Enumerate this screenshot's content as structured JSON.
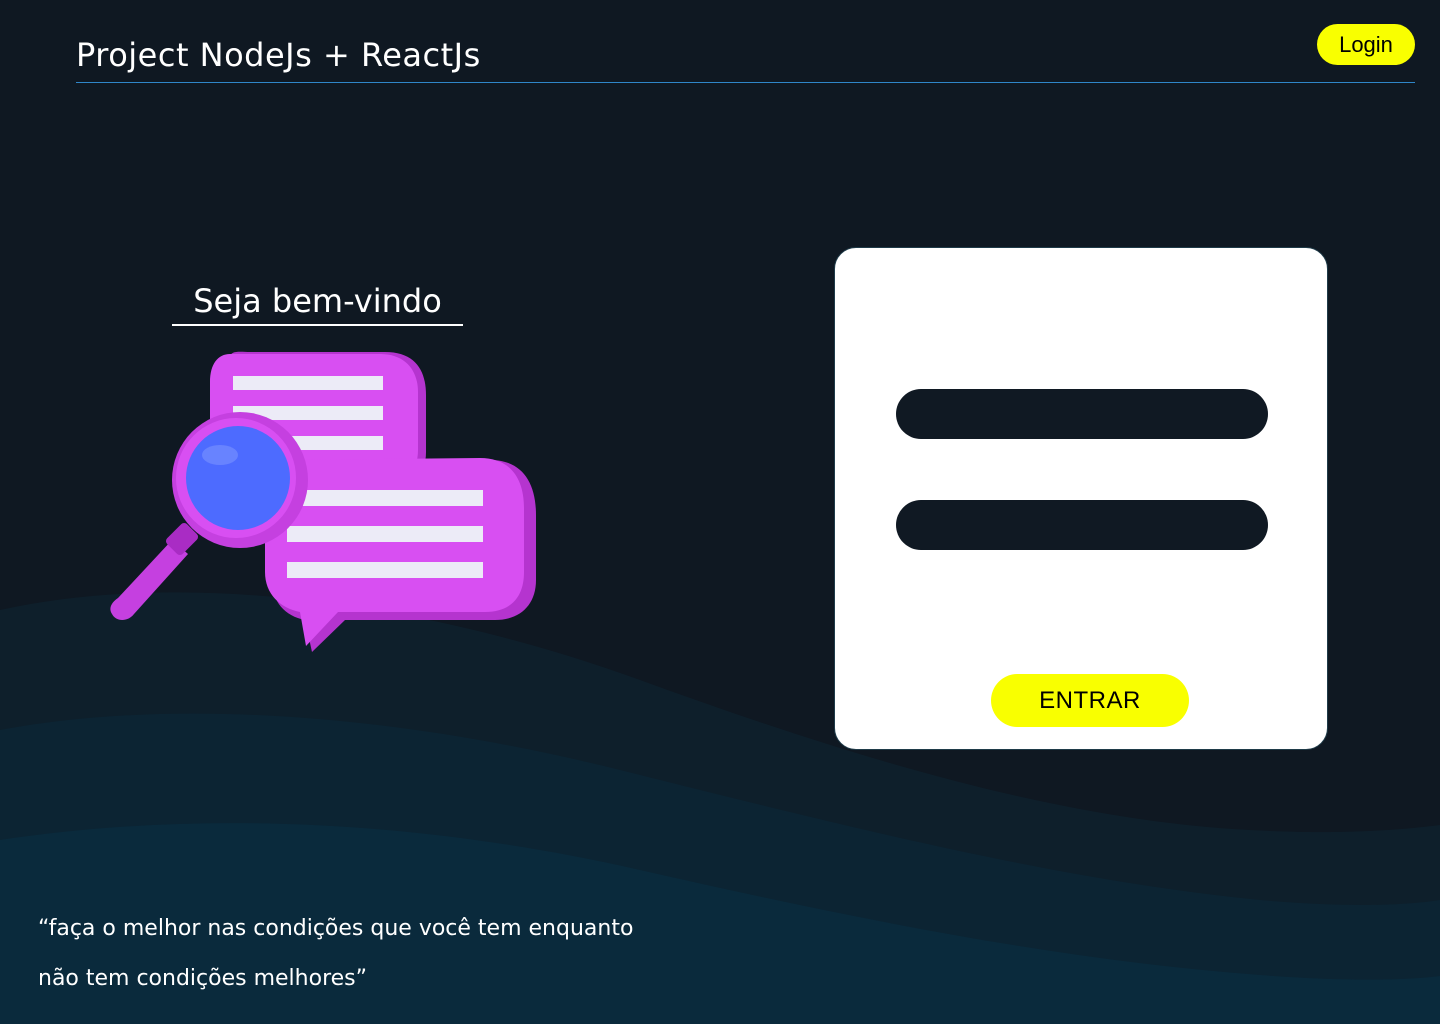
{
  "header": {
    "title": "Project NodeJs + ReactJs",
    "login_label": "Login"
  },
  "hero": {
    "welcome": "Seja bem-vindo",
    "illustration_icon": "chat-bubbles-search-icon"
  },
  "login_form": {
    "email_value": "",
    "password_value": "",
    "submit_label": "ENTRAR"
  },
  "quote": {
    "line1": "“faça o melhor nas condições que você tem enquanto",
    "line2": "não tem condições melhores”"
  },
  "colors": {
    "background": "#0f1822",
    "accent": "#f9ff00",
    "header_line": "#2f86c9",
    "illustration": "#d84ff2",
    "lens": "#4d6bff"
  }
}
